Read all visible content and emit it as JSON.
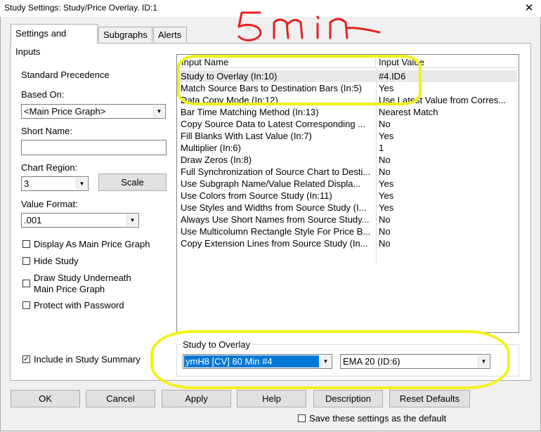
{
  "window": {
    "title": "Study Settings: Study/Price Overlay. ID:1",
    "close_glyph": "✕"
  },
  "tabs": [
    "Settings and Inputs",
    "Subgraphs",
    "Alerts"
  ],
  "left": {
    "standard_precedence": "Standard Precedence",
    "based_on_label": "Based On:",
    "based_on_value": "<Main Price Graph>",
    "short_name_label": "Short Name:",
    "short_name_value": "",
    "chart_region_label": "Chart Region:",
    "chart_region_value": "3",
    "scale_button": "Scale",
    "value_format_label": "Value Format:",
    "value_format_value": ".001",
    "checks": [
      {
        "label": "Display As Main Price Graph",
        "checked": false
      },
      {
        "label": "Hide Study",
        "checked": false
      },
      {
        "label": "Draw Study Underneath",
        "label2": "Main Price Graph",
        "checked": false
      },
      {
        "label": "Protect with Password",
        "checked": false
      }
    ],
    "include_summary": {
      "label": "Include in Study Summary",
      "checked": true,
      "mark": "✓"
    }
  },
  "grid": {
    "headers": [
      "Input Name",
      "Input Value"
    ],
    "rows": [
      {
        "name": "Study to Overlay  (In:10)",
        "value": "#4.ID6"
      },
      {
        "name": "Match Source Bars to Destination Bars  (In:5)",
        "value": "Yes"
      },
      {
        "name": "Data Copy Mode  (In:12)",
        "value": "Use Latest Value from Corres..."
      },
      {
        "name": "Bar Time Matching Method  (In:13)",
        "value": "Nearest Match"
      },
      {
        "name": "Copy Source Data to Latest Corresponding ...",
        "value": "No"
      },
      {
        "name": "Fill Blanks With Last Value  (In:7)",
        "value": "Yes"
      },
      {
        "name": "Multiplier  (In:6)",
        "value": "1"
      },
      {
        "name": "Draw Zeros  (In:8)",
        "value": "No"
      },
      {
        "name": "Full Synchronization of Source Chart to Desti...",
        "value": "No"
      },
      {
        "name": "Use Subgraph Name/Value Related Displa...",
        "value": "Yes"
      },
      {
        "name": "Use Colors from Source Study  (In:11)",
        "value": "Yes"
      },
      {
        "name": "Use Styles and Widths from Source Study  (I...",
        "value": "Yes"
      },
      {
        "name": "Always Use Short Names from Source Study...",
        "value": "No"
      },
      {
        "name": "Use Multicolumn Rectangle Style For Price B...",
        "value": "No"
      },
      {
        "name": "Copy Extension Lines from Source Study  (In...",
        "value": "No"
      }
    ]
  },
  "overlay": {
    "group_label": "Study to Overlay",
    "chart_value": "ymH8 [CV]  60 Min  #4",
    "study_value": "EMA 20 (ID:6)"
  },
  "buttons": [
    "OK",
    "Cancel",
    "Apply",
    "Help",
    "Description",
    "Reset Defaults"
  ],
  "save_default": {
    "label": "Save these settings as the default",
    "checked": false
  },
  "annotation": {
    "text": "5min",
    "highlight_color": "#f2f21a",
    "selection_color": "#0078d7"
  }
}
